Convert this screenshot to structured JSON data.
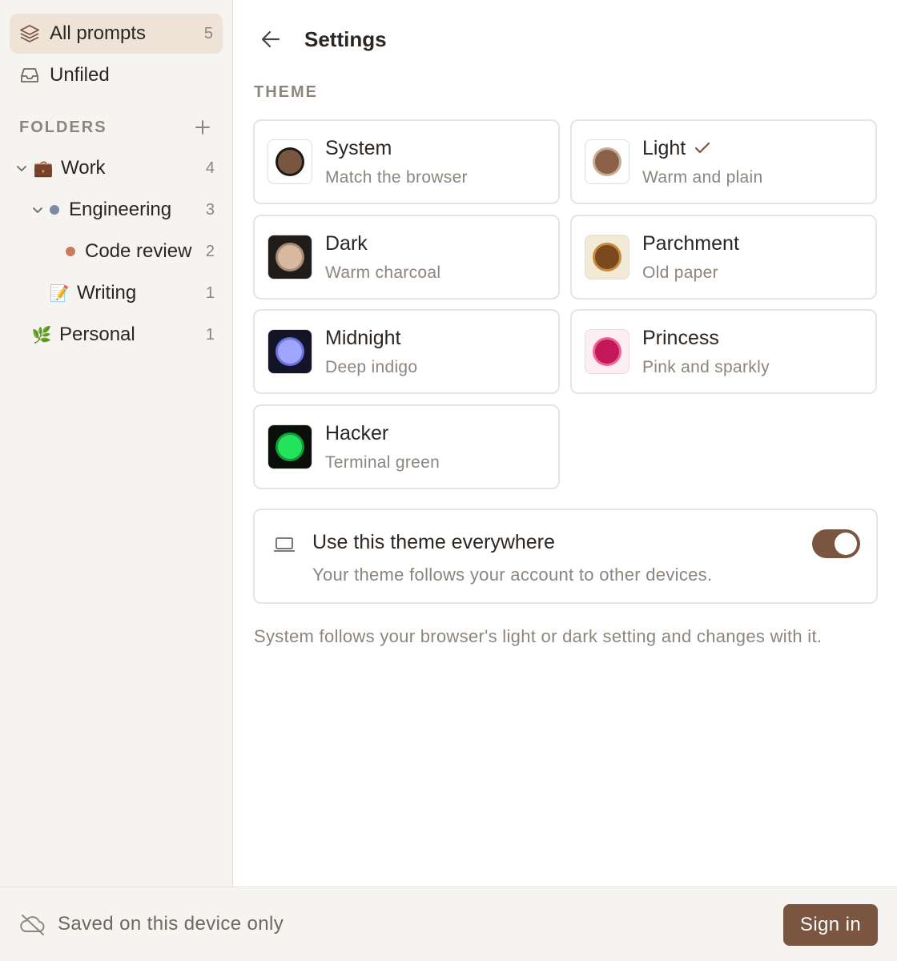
{
  "sidebar": {
    "nav": [
      {
        "label": "All prompts",
        "count": "5",
        "icon": "layers-icon"
      },
      {
        "label": "Unfiled",
        "count": "",
        "icon": "inbox-icon"
      }
    ],
    "folders_title": "FOLDERS",
    "tree": [
      {
        "label": "Work",
        "count": "4",
        "icon": "briefcase-icon",
        "glyph": "💼",
        "expanded": true
      },
      {
        "label": "Engineering",
        "count": "3",
        "dot_color": "#7c8aa8",
        "expanded": true
      },
      {
        "label": "Code review",
        "count": "2",
        "dot_color": "#c97b5e"
      },
      {
        "label": "Writing",
        "count": "1",
        "icon": "memo-icon",
        "glyph": "📝"
      },
      {
        "label": "Personal",
        "count": "1",
        "icon": "herb-icon",
        "glyph": "🌿"
      }
    ]
  },
  "main": {
    "title": "Settings",
    "section": "THEME",
    "themes": [
      {
        "name": "System",
        "desc": "Match the browser",
        "swatch_bg": "#ffffff",
        "dot": "#7a5540",
        "ring": "#1a1a1a",
        "selected": false
      },
      {
        "name": "Light",
        "desc": "Warm and plain",
        "swatch_bg": "#ffffff",
        "dot": "#8a6248",
        "ring": "#c7ab97",
        "selected": true
      },
      {
        "name": "Dark",
        "desc": "Warm charcoal",
        "swatch_bg": "#1f1c1a",
        "dot": "#d8b9a0",
        "ring": "#a88b74",
        "selected": false
      },
      {
        "name": "Parchment",
        "desc": "Old paper",
        "swatch_bg": "#f3ead6",
        "dot": "#7a4a1e",
        "ring": "#c78a3a",
        "selected": false
      },
      {
        "name": "Midnight",
        "desc": "Deep indigo",
        "swatch_bg": "#141428",
        "dot": "#9ea6ff",
        "ring": "#6b72d9",
        "selected": false
      },
      {
        "name": "Princess",
        "desc": "Pink and sparkly",
        "swatch_bg": "#fdeef2",
        "dot": "#c2185b",
        "ring": "#f06292",
        "selected": false
      },
      {
        "name": "Hacker",
        "desc": "Terminal green",
        "swatch_bg": "#0a0f0a",
        "dot": "#22e35a",
        "ring": "#0f9e3a",
        "selected": false
      }
    ],
    "sync": {
      "title": "Use this theme everywhere",
      "desc": "Your theme follows your account to other devices.",
      "enabled": true
    },
    "note": "System follows your browser's light or dark setting and changes with it."
  },
  "footer": {
    "status": "Saved on this device only",
    "signin_label": "Sign in"
  },
  "colors": {
    "accent": "#7a5540",
    "selected_bg": "#f2e6dc",
    "sidebar_bg": "#f6f4f0"
  }
}
